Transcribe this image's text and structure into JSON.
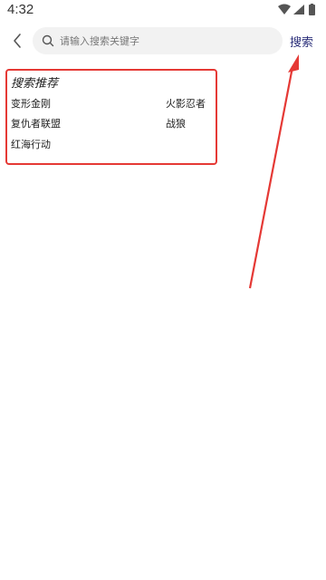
{
  "status_bar": {
    "time": "4:32",
    "icons": [
      "wifi-icon",
      "cellular-signal-icon",
      "battery-icon"
    ]
  },
  "header": {
    "back_icon": "chevron-left-icon",
    "search_icon": "search-icon",
    "search_placeholder": "请输入搜索关键字",
    "search_value": "",
    "search_button_label": "搜索"
  },
  "recommend": {
    "title": "搜索推荐",
    "items": [
      "变形金刚",
      "火影忍者",
      "复仇者联盟",
      "战狼",
      "红海行动"
    ]
  },
  "annotation": {
    "box_color": "#e53935",
    "arrow_color": "#e53935"
  }
}
